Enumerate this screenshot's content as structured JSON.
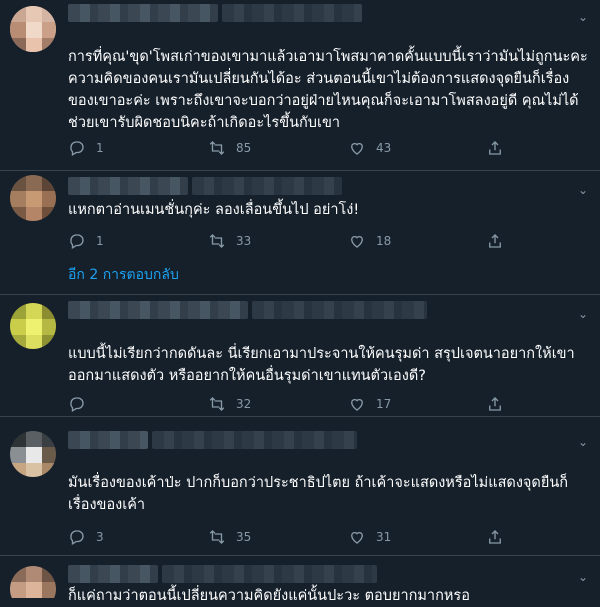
{
  "tweets": [
    {
      "text": "การที่คุณ'ขุด'โพสเก่าของเขามาแล้วเอามาโพสมาคาดคั้นแบบนี้เราว่ามันไม่ถูกนะคะ ความคิดของคนเรามันเปลี่ยนกันได้อะ ส่วนตอนนี้เขาไม่ต้องการแสดงจุดยืนก็เรื่องของเขาอะค่ะ เพราะถึงเขาจะบอกว่าอยู่ฝ่ายไหนคุณก็จะเอามาโพสลงอยู่ดี คุณไม่ได้ช่วยเขารับผิดชอบนิคะถ้าเกิดอะไรขึ้นกับเขา",
      "replies": "1",
      "retweets": "85",
      "likes": "43"
    },
    {
      "text": "แหกตาอ่านเมนชั่นกุค่ะ ลองเลื่อนขึ้นไป อย่าโง่!",
      "replies": "1",
      "retweets": "33",
      "likes": "18"
    },
    {
      "text": "แบบนี้ไม่เรียกว่ากดดันละ นี่เรียกเอามาประจานให้คนรุมด่า สรุปเจตนาอยากให้เขาออกมาแสดงตัว หรืออยากให้คนอื่นรุมด่าเขาแทนตัวเองดี?",
      "replies": "",
      "retweets": "32",
      "likes": "17"
    },
    {
      "text": "มันเรื่องของเค้าป่ะ ปากก็บอกว่าประชาธิปไตย ถ้าเค้าจะแสดงหรือไม่แสดงจุดยืนก็เรื่องของเค้า",
      "replies": "3",
      "retweets": "35",
      "likes": "31"
    },
    {
      "text": "ก็แค่ถามว่าตอนนี้เปลี่ยนความคิดยังแค่นั้นปะวะ ตอบยากมากหรอ",
      "replies": "",
      "retweets": "",
      "likes": ""
    }
  ],
  "more_replies_label": "อีก 2 การตอบกลับ",
  "icons": {
    "reply": "reply-icon",
    "retweet": "retweet-icon",
    "like": "heart-icon",
    "share": "share-icon",
    "more": "chevron-down-icon"
  },
  "colors": {
    "background": "#15202b",
    "muted": "#8899a6",
    "link": "#1da1f2",
    "divider": "#38444d"
  }
}
